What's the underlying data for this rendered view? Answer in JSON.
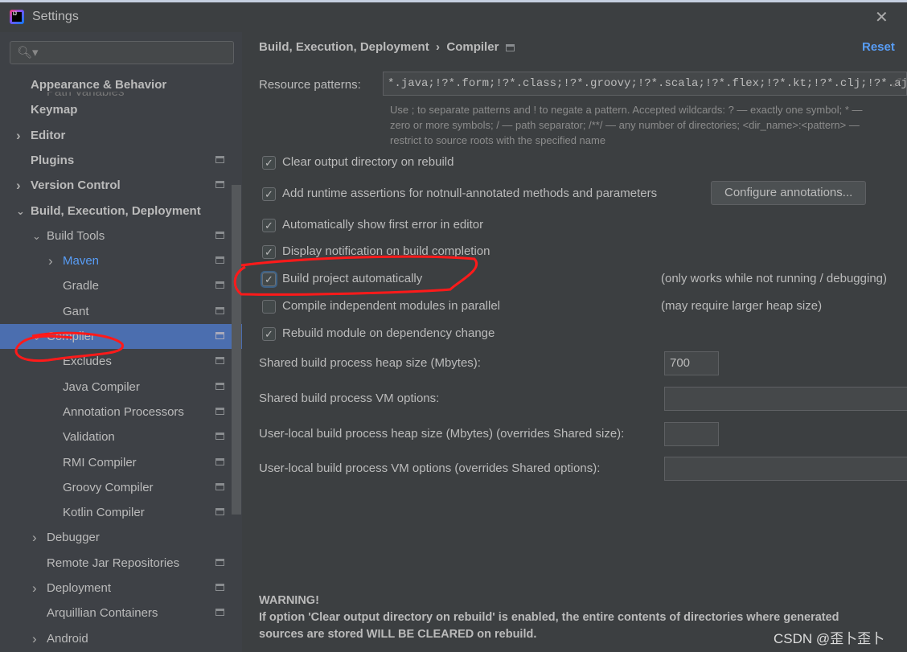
{
  "window": {
    "title": "Settings",
    "close_icon": "close-icon"
  },
  "sidebar": {
    "search_placeholder": "",
    "ghost": "Path Variables",
    "items": [
      {
        "label": "Appearance & Behavior",
        "bold": true,
        "indent": 0,
        "arrow": ""
      },
      {
        "label": "Keymap",
        "bold": true,
        "indent": 0,
        "arrow": ""
      },
      {
        "label": "Editor",
        "bold": true,
        "indent": 0,
        "arrow": "right"
      },
      {
        "label": "Plugins",
        "bold": true,
        "indent": 0,
        "arrow": "",
        "page": true
      },
      {
        "label": "Version Control",
        "bold": true,
        "indent": 0,
        "arrow": "right",
        "page": true
      },
      {
        "label": "Build, Execution, Deployment",
        "bold": true,
        "indent": 0,
        "arrow": "down"
      },
      {
        "label": "Build Tools",
        "indent": 1,
        "arrow": "down",
        "page": true
      },
      {
        "label": "Maven",
        "indent": 2,
        "arrow": "right",
        "page": true,
        "link": true
      },
      {
        "label": "Gradle",
        "indent": 2,
        "arrow": "",
        "page": true
      },
      {
        "label": "Gant",
        "indent": 2,
        "arrow": "",
        "page": true
      },
      {
        "label": "Compiler",
        "indent": 1,
        "arrow": "down",
        "page": true,
        "selected": true
      },
      {
        "label": "Excludes",
        "indent": 2,
        "arrow": "",
        "page": true
      },
      {
        "label": "Java Compiler",
        "indent": 2,
        "arrow": "",
        "page": true
      },
      {
        "label": "Annotation Processors",
        "indent": 2,
        "arrow": "",
        "page": true
      },
      {
        "label": "Validation",
        "indent": 2,
        "arrow": "",
        "page": true
      },
      {
        "label": "RMI Compiler",
        "indent": 2,
        "arrow": "",
        "page": true
      },
      {
        "label": "Groovy Compiler",
        "indent": 2,
        "arrow": "",
        "page": true
      },
      {
        "label": "Kotlin Compiler",
        "indent": 2,
        "arrow": "",
        "page": true
      },
      {
        "label": "Debugger",
        "indent": 1,
        "arrow": "right"
      },
      {
        "label": "Remote Jar Repositories",
        "indent": 1,
        "arrow": "",
        "page": true
      },
      {
        "label": "Deployment",
        "indent": 1,
        "arrow": "right",
        "page": true
      },
      {
        "label": "Arquillian Containers",
        "indent": 1,
        "arrow": "",
        "page": true
      },
      {
        "label": "Android",
        "indent": 1,
        "arrow": "right"
      }
    ]
  },
  "main": {
    "breadcrumb": [
      "Build, Execution, Deployment",
      "Compiler"
    ],
    "breadcrumb_sep": "›",
    "reset": "Reset",
    "resource_label": "Resource patterns:",
    "resource_value": "*.java;!?*.form;!?*.class;!?*.groovy;!?*.scala;!?*.flex;!?*.kt;!?*.clj;!?*.aj",
    "hint": [
      "Use ; to separate patterns and ! to negate a pattern. Accepted wildcards: ? — exactly one symbol; * —",
      "zero or more symbols; / — path separator; /**/ — any number of directories; <dir_name>:<pattern> —",
      "restrict to source roots with the specified name"
    ],
    "checkboxes": [
      {
        "label": "Clear output directory on rebuild",
        "checked": true
      },
      {
        "label": "Add runtime assertions for notnull-annotated methods and parameters",
        "checked": true
      },
      {
        "label": "Automatically show first error in editor",
        "checked": true
      },
      {
        "label": "Display notification on build completion",
        "checked": true
      },
      {
        "label": "Build project automatically",
        "checked": true,
        "note": "(only works while not running / debugging)"
      },
      {
        "label": "Compile independent modules in parallel",
        "checked": false,
        "note": "(may require larger heap size)"
      },
      {
        "label": "Rebuild module on dependency change",
        "checked": true
      }
    ],
    "configure_button": "Configure annotations...",
    "fields": [
      {
        "label": "Shared build process heap size (Mbytes):",
        "value": "700"
      },
      {
        "label": "Shared build process VM options:",
        "value": ""
      },
      {
        "label": "User-local build process heap size (Mbytes) (overrides Shared size):",
        "value": ""
      },
      {
        "label": "User-local build process VM options (overrides Shared options):",
        "value": ""
      }
    ],
    "warning_title": "WARNING!",
    "warning_lines": [
      "If option 'Clear output directory on rebuild' is enabled, the entire contents of directories where generated",
      "sources are stored WILL BE CLEARED on rebuild."
    ]
  },
  "watermark": "CSDN @歪卜歪卜",
  "colors": {
    "selection": "#4b6eaf",
    "link": "#589df6",
    "annotation": "#ff1a1a"
  }
}
